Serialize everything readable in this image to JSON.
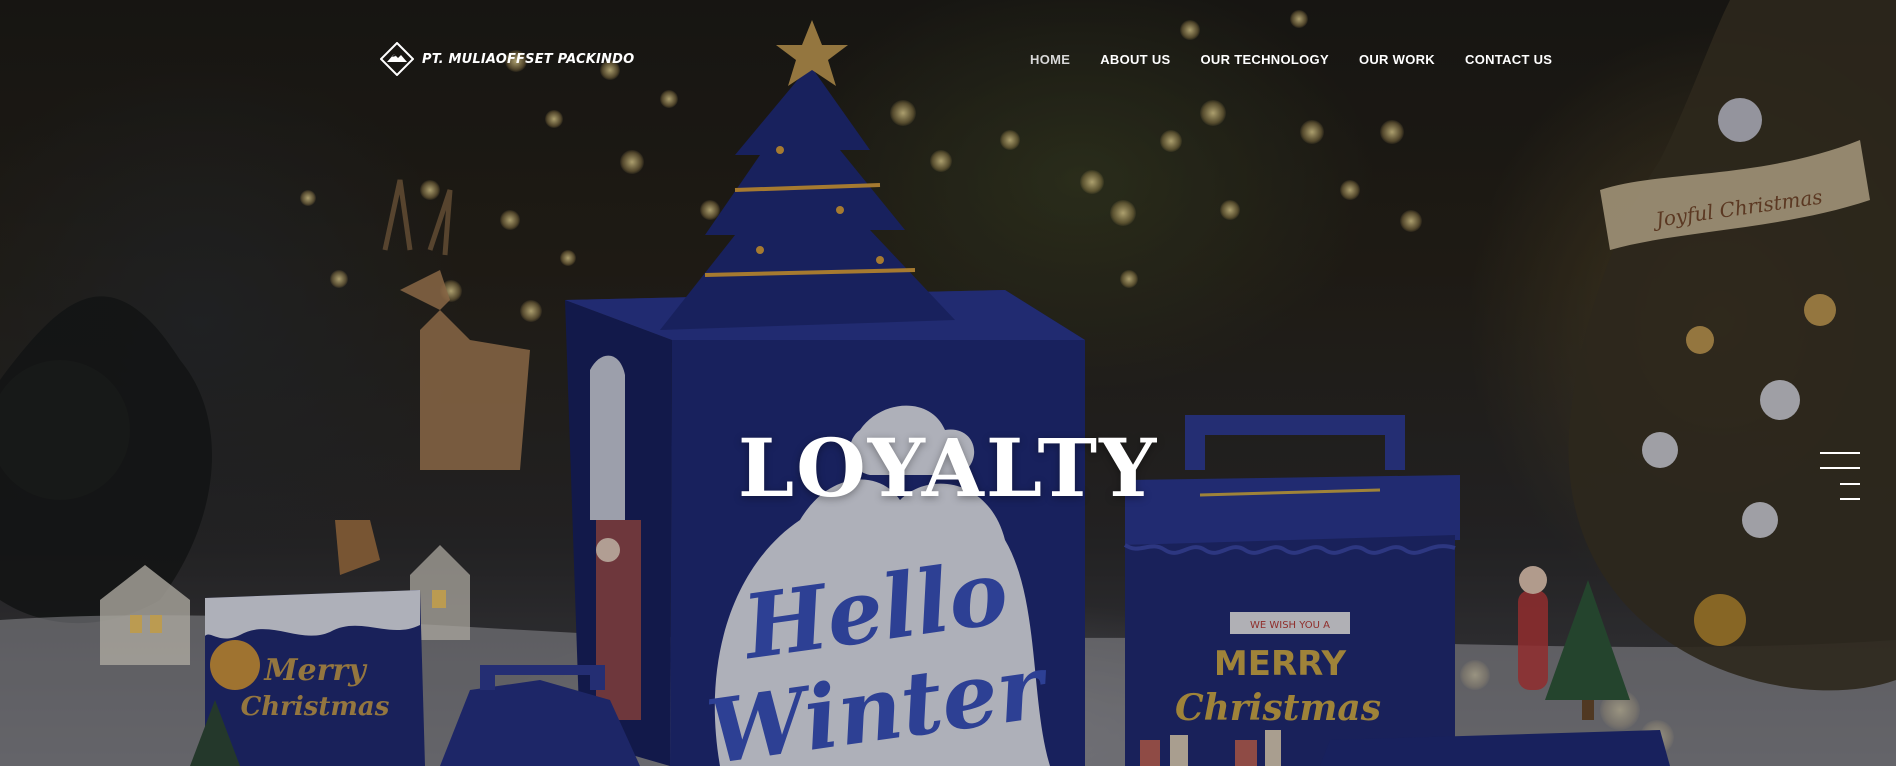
{
  "brand": {
    "name": "PT. MULIAOFFSET PACKINDO",
    "logo_icon": "diamond-mountain-logo-icon"
  },
  "nav": {
    "items": [
      {
        "label": "HOME",
        "active": true
      },
      {
        "label": "ABOUT US",
        "active": false
      },
      {
        "label": "OUR TECHNOLOGY",
        "active": false
      },
      {
        "label": "OUR WORK",
        "active": false
      },
      {
        "label": "CONTACT US",
        "active": false
      }
    ]
  },
  "hero": {
    "title": "LOYALTY",
    "scene": {
      "box_center_text_1": "Hello",
      "box_center_text_2": "Winter",
      "box_right_banner": "WE WISH YOU A",
      "box_right_text_1": "MERRY",
      "box_right_text_2": "Christmas",
      "card_text_1": "Merry",
      "card_text_2": "Christmas",
      "ribbon_text": "Joyful Christmas"
    }
  },
  "menu_toggle": {
    "icon": "hamburger-menu-icon"
  },
  "colors": {
    "nav_text": "#ffffff",
    "box_blue": "#1f2a78",
    "box_gold": "#d9b24a",
    "title": "#ffffff"
  }
}
